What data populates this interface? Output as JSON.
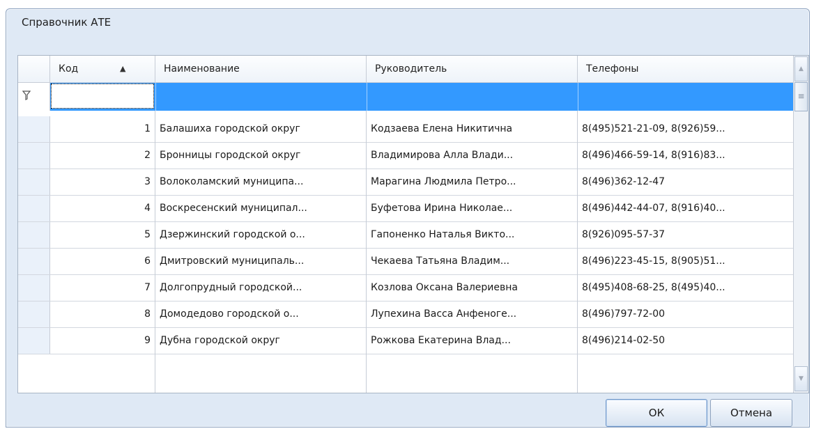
{
  "window": {
    "title": "Справочник АТЕ"
  },
  "grid": {
    "columns": [
      {
        "label": "Код",
        "sorted": "ascending"
      },
      {
        "label": "Наименование"
      },
      {
        "label": "Руководитель"
      },
      {
        "label": "Телефоны"
      }
    ],
    "sort_indicator": "▲",
    "filter_icon": "filter-icon",
    "rows": [
      {
        "code": "1",
        "name": "Балашиха городской округ",
        "head": "Кодзаева Елена Никитична",
        "phones": "8(495)521-21-09, 8(926)59..."
      },
      {
        "code": "2",
        "name": "Бронницы городской округ",
        "head": "Владимирова Алла Влади...",
        "phones": "8(496)466-59-14, 8(916)83..."
      },
      {
        "code": "3",
        "name": "Волоколамский муниципа...",
        "head": "Марагина Людмила Петро...",
        "phones": "8(496)362-12-47"
      },
      {
        "code": "4",
        "name": "Воскресенский муниципал...",
        "head": "Буфетова Ирина Николае...",
        "phones": "8(496)442-44-07, 8(916)40..."
      },
      {
        "code": "5",
        "name": "Дзержинский городской о...",
        "head": "Гапоненко Наталья Викто...",
        "phones": "8(926)095-57-37"
      },
      {
        "code": "6",
        "name": "Дмитровский муниципаль...",
        "head": "Чекаева Татьяна Владим...",
        "phones": "8(496)223-45-15, 8(905)51..."
      },
      {
        "code": "7",
        "name": "Долгопрудный городской...",
        "head": "Козлова Оксана Валериевна",
        "phones": "8(495)408-68-25, 8(495)40..."
      },
      {
        "code": "8",
        "name": "Домодедово городской о...",
        "head": "Лупехина Васса Анфеноге...",
        "phones": "8(496)797-72-00"
      },
      {
        "code": "9",
        "name": "Дубна городской округ",
        "head": "Рожкова Екатерина Влад...",
        "phones": "8(496)214-02-50"
      }
    ]
  },
  "buttons": {
    "ok": "ОК",
    "cancel": "Отмена"
  },
  "colors": {
    "selection": "#3399ff",
    "window_bg": "#dfe9f5"
  }
}
